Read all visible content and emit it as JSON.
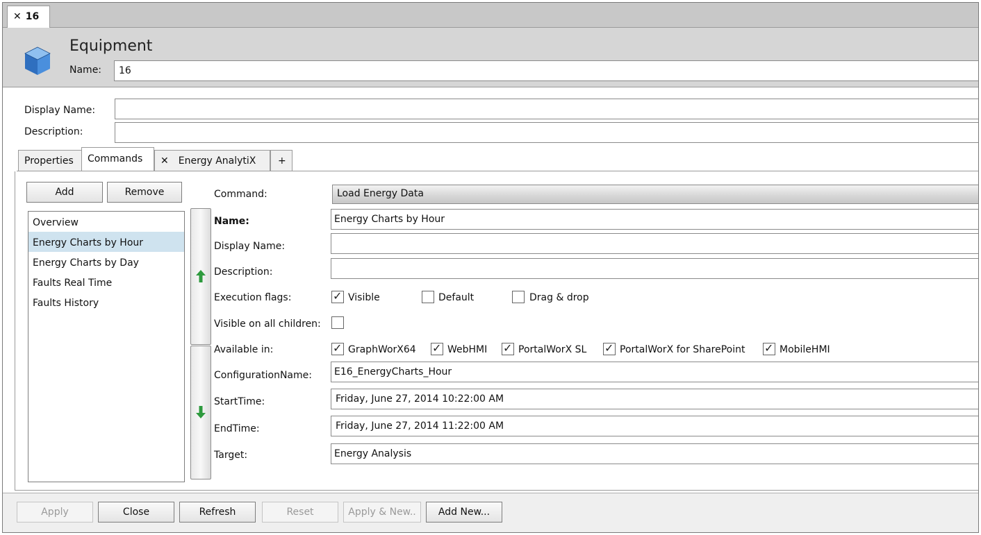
{
  "document_tab": {
    "close": "✕",
    "label": "16"
  },
  "header": {
    "title": "Equipment",
    "name_label": "Name:",
    "name_value": "16"
  },
  "general": {
    "display_name_label": "Display Name:",
    "display_name_value": "",
    "description_label": "Description:",
    "description_value": ""
  },
  "tabs": [
    {
      "label": "Properties"
    },
    {
      "label": "Commands"
    },
    {
      "label": "Energy AnalytiX",
      "close": "✕"
    },
    {
      "label": "+"
    }
  ],
  "commands": {
    "add_label": "Add",
    "remove_label": "Remove",
    "items": [
      {
        "label": "Overview"
      },
      {
        "label": "Energy Charts by Hour",
        "selected": true
      },
      {
        "label": "Energy Charts by Day"
      },
      {
        "label": "Faults Real Time"
      },
      {
        "label": "Faults History"
      }
    ]
  },
  "detail": {
    "command_label": "Command:",
    "command_value": "Load Energy Data",
    "name_label": "Name:",
    "name_value": "Energy Charts by Hour",
    "display_name_label": "Display Name:",
    "display_name_value": "",
    "description_label": "Description:",
    "description_value": "",
    "execution_flags_label": "Execution flags:",
    "flags": [
      {
        "label": "Visible",
        "checked": true
      },
      {
        "label": "Default",
        "checked": false
      },
      {
        "label": "Drag & drop",
        "checked": false
      }
    ],
    "visible_children_label": "Visible on all children:",
    "visible_children_checked": false,
    "available_in_label": "Available in:",
    "available_in": [
      {
        "label": "GraphWorX64",
        "checked": true
      },
      {
        "label": "WebHMI",
        "checked": true
      },
      {
        "label": "PortalWorX SL",
        "checked": true
      },
      {
        "label": "PortalWorX for SharePoint",
        "checked": true
      },
      {
        "label": "MobileHMI",
        "checked": true
      }
    ],
    "config_name_label": "ConfigurationName:",
    "config_name_value": "E16_EnergyCharts_Hour",
    "start_time_label": "StartTime:",
    "start_time_value": "Friday, June 27, 2014 10:22:00 AM",
    "end_time_label": "EndTime:",
    "end_time_value": "Friday, June 27, 2014 11:22:00 AM",
    "target_label": "Target:",
    "target_value": "Energy Analysis"
  },
  "footer": {
    "apply": "Apply",
    "close": "Close",
    "refresh": "Refresh",
    "reset": "Reset",
    "apply_new": "Apply & New..",
    "add_new": "Add New..."
  },
  "colors": {
    "selected_row": "#cfe3ef",
    "arrow_green": "#2e9a3e",
    "cube_blue": "#3b7fd0"
  }
}
